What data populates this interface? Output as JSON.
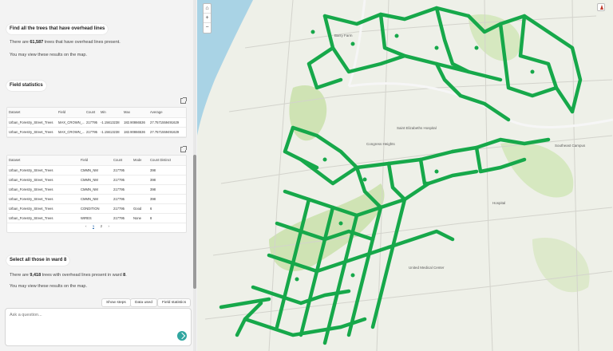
{
  "chat": {
    "q1_heading": "Find all the trees that have overhead lines",
    "q1_answer_pre": "There are ",
    "q1_answer_count": "61,587",
    "q1_answer_post": " trees that have overhead lines present.",
    "q1_map_note": "You may view these results on the map.",
    "field_stats_heading": "Field statistics",
    "q2_heading": "Select all those in ward 8",
    "q2_answer_pre": "There are ",
    "q2_answer_count": "9,418",
    "q2_answer_mid": " trees with overhead lines present in ward ",
    "q2_answer_ward": "8",
    "q2_answer_post": ".",
    "q2_map_note": "You may view these results on the map."
  },
  "stats_table1": {
    "headers": [
      "Dataset",
      "Field",
      "Count",
      "Min",
      "Max",
      "Average"
    ],
    "rows": [
      [
        "Urban_Forestry_Street_Trees",
        "MAX_CROWN_...",
        "217795",
        "-1.15613238",
        "182.90866536",
        "27.7571559491629"
      ],
      [
        "Urban_Forestry_Street_Trees",
        "MAX_CROWN_...",
        "217795",
        "-1.15613238",
        "182.90866536",
        "27.7571559491629"
      ]
    ]
  },
  "stats_table2": {
    "headers": [
      "Dataset",
      "Field",
      "Count",
      "Mode",
      "Count Distinct"
    ],
    "rows": [
      [
        "Urban_Forestry_Street_Trees",
        "CMMN_NM",
        "217795",
        "",
        "398"
      ],
      [
        "Urban_Forestry_Street_Trees",
        "CMMN_NM",
        "217795",
        "",
        "398"
      ],
      [
        "Urban_Forestry_Street_Trees",
        "CMMN_NM",
        "217795",
        "",
        "398"
      ],
      [
        "Urban_Forestry_Street_Trees",
        "CMMN_NM",
        "217795",
        "",
        "398"
      ],
      [
        "Urban_Forestry_Street_Trees",
        "CONDITION",
        "217795",
        "Good",
        "6"
      ],
      [
        "Urban_Forestry_Street_Trees",
        "WIRES",
        "217795",
        "None",
        "8"
      ]
    ]
  },
  "pager": {
    "prev": "‹",
    "pages": [
      "1",
      "2"
    ],
    "next": "›"
  },
  "actions": {
    "show_steps": "Show steps",
    "data_used": "Data used",
    "field_statistics": "Field statistics"
  },
  "ask": {
    "placeholder": "Ask a question..."
  },
  "map": {
    "labels": {
      "barry_farm": "Barry Farm",
      "saint_elizabeths": "Saint Elizabeths Hospital",
      "congress_heights": "Congress Heights",
      "united_medical": "United Medical Center",
      "hospital_west": "Hospital",
      "southeast_campus": "Southeast Campus"
    },
    "zoom_in": "+",
    "zoom_out": "−",
    "home": "⌂"
  },
  "colors": {
    "tree_green": "#16a84a",
    "river": "#a9d3e5",
    "park": "#cfe3b4"
  }
}
